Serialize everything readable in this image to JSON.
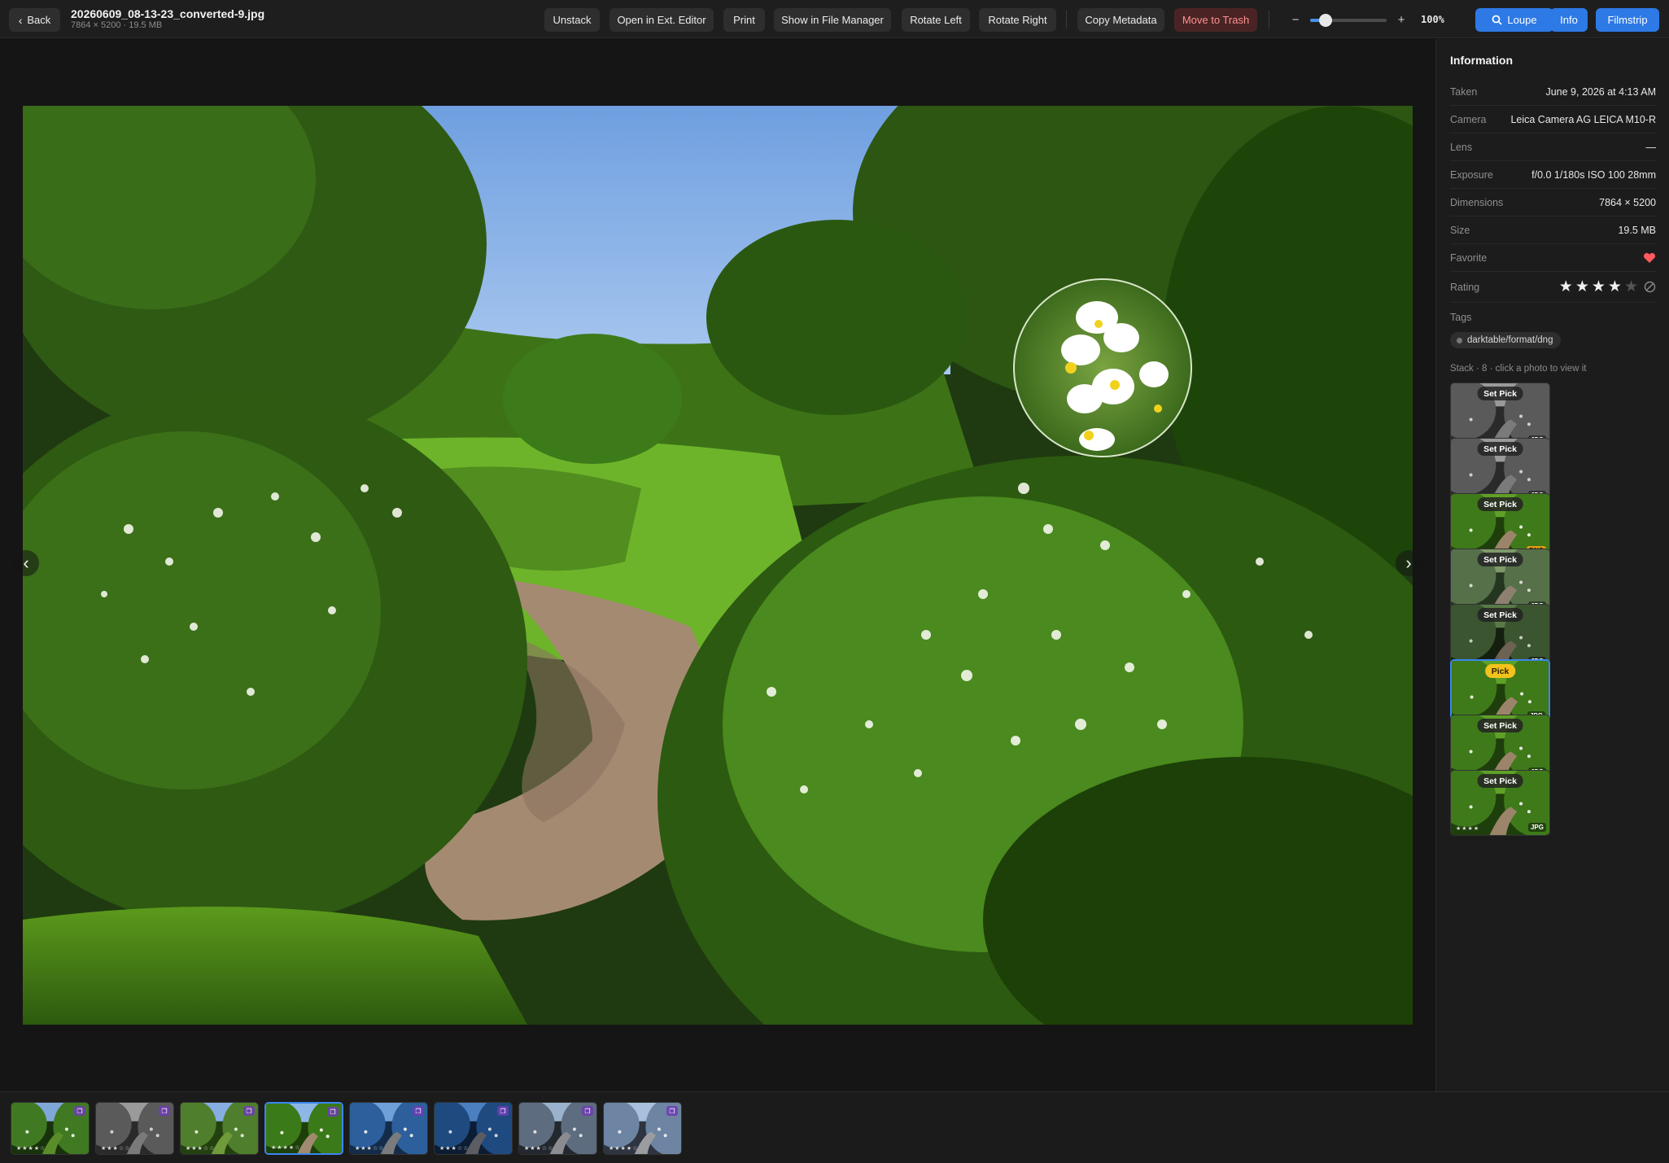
{
  "header": {
    "back_label": "Back",
    "file_name": "20260609_08-13-23_converted-9.jpg",
    "file_meta": "7864 × 5200 · 19.5 MB",
    "actions": {
      "unstack": "Unstack",
      "open_ext": "Open in Ext. Editor",
      "print": "Print",
      "show_fm": "Show in File Manager",
      "rotate_left": "Rotate Left",
      "rotate_right": "Rotate Right",
      "copy_meta": "Copy Metadata",
      "trash": "Move to Trash"
    },
    "zoom": {
      "minus": "−",
      "plus": "+",
      "value": "100%",
      "slider_fraction": 0.2
    },
    "views": {
      "loupe": "Loupe",
      "info": "Info",
      "filmstrip": "Filmstrip"
    }
  },
  "info": {
    "title": "Information",
    "rows": {
      "taken": {
        "label": "Taken",
        "value": "June 9, 2026 at 4:13 AM"
      },
      "camera": {
        "label": "Camera",
        "value": "Leica Camera AG LEICA M10-R"
      },
      "lens": {
        "label": "Lens",
        "value": "—"
      },
      "exposure": {
        "label": "Exposure",
        "value": "f/0.0 1/180s ISO 100 28mm"
      },
      "dimensions": {
        "label": "Dimensions",
        "value": "7864 × 5200"
      },
      "size": {
        "label": "Size",
        "value": "19.5 MB"
      },
      "favorite": {
        "label": "Favorite",
        "value": true
      },
      "rating": {
        "label": "Rating",
        "value": 4,
        "max": 5
      }
    },
    "tags_label": "Tags",
    "tags": [
      "darktable/format/dng"
    ],
    "stack_label": "Stack · 8 · click a photo to view it",
    "stack": [
      {
        "badge": "Set Pick",
        "format": "JPG",
        "tone": "bw"
      },
      {
        "badge": "Set Pick",
        "format": "JPG",
        "tone": "bw"
      },
      {
        "badge": "Set Pick",
        "format": "DNG",
        "tone": "color"
      },
      {
        "badge": "Set Pick",
        "format": "JPG",
        "tone": "muted"
      },
      {
        "badge": "Set Pick",
        "format": "JPG",
        "tone": "dark"
      },
      {
        "badge": "Pick",
        "format": "JPG",
        "tone": "color",
        "active": true
      },
      {
        "badge": "Set Pick",
        "format": "JPG",
        "tone": "color"
      },
      {
        "badge": "Set Pick",
        "format": "JPG",
        "tone": "color"
      }
    ]
  },
  "filmstrip": [
    {
      "scene": "meadow",
      "rating": 4
    },
    {
      "scene": "bw",
      "rating": 3
    },
    {
      "scene": "field",
      "rating": 3
    },
    {
      "scene": "path",
      "rating": 4,
      "active": true
    },
    {
      "scene": "coast",
      "rating": 3
    },
    {
      "scene": "coast-dark",
      "rating": 3
    },
    {
      "scene": "rocks",
      "rating": 3
    },
    {
      "scene": "rocks-bright",
      "rating": 4
    }
  ],
  "colors": {
    "accent": "#2d79e6",
    "danger_text": "#ff8f8f",
    "favorite": "#ff5a5f",
    "pick": "#f4c21c",
    "dng": "#e39a13"
  }
}
